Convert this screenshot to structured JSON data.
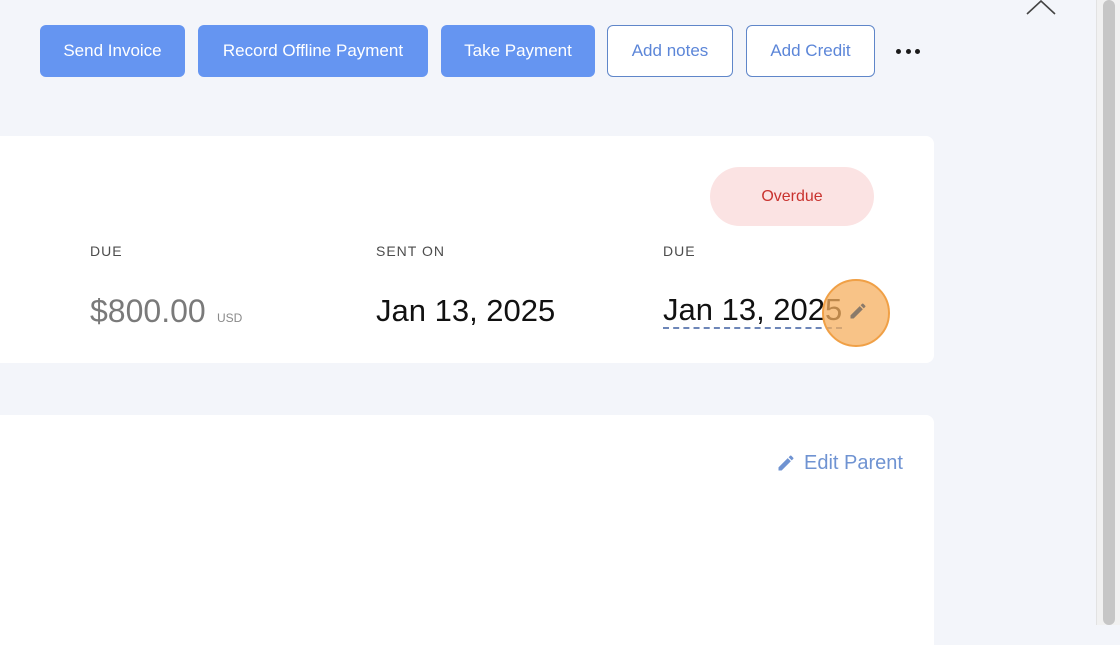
{
  "toolbar": {
    "send_invoice": "Send Invoice",
    "record_offline_payment": "Record Offline Payment",
    "take_payment": "Take Payment",
    "add_notes": "Add notes",
    "add_credit": "Add Credit",
    "more_icon": "more-horizontal-icon"
  },
  "summary": {
    "status": "Overdue",
    "due_label": "DUE",
    "amount": "$800.00",
    "currency": "USD",
    "sent_on_label": "SENT ON",
    "sent_on": "Jan 13, 2025",
    "due_date_label": "DUE",
    "due_date": "Jan 13, 2025",
    "edit_icon": "pencil-icon"
  },
  "parent": {
    "edit_parent": "Edit Parent",
    "edit_icon": "pencil-icon"
  },
  "colors": {
    "primary": "#6595f1",
    "outline": "#5f86c9",
    "overdue_bg": "#fbe3e3",
    "overdue_text": "#c9332f",
    "link": "#6f93d2"
  }
}
